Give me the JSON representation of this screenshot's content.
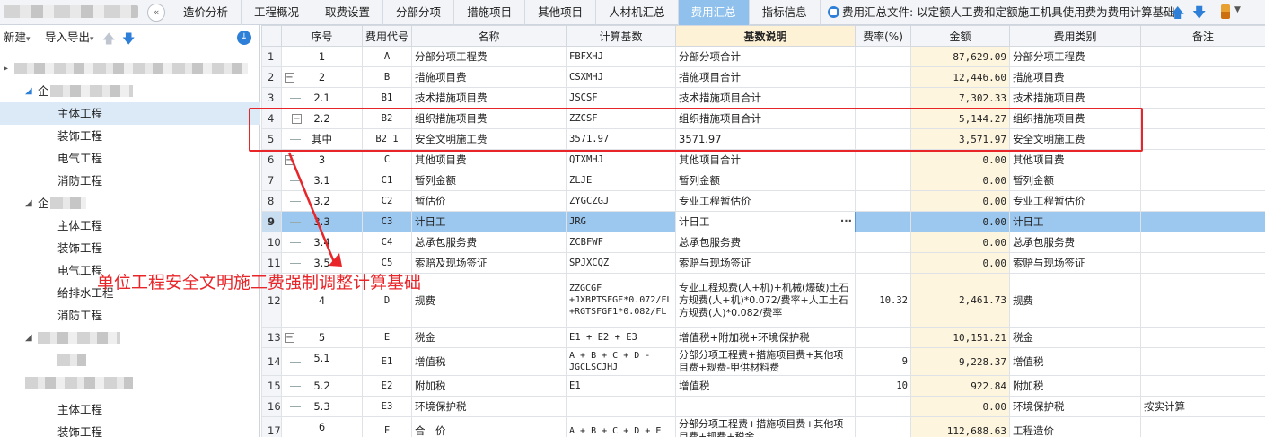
{
  "tabs": [
    "造价分析",
    "工程概况",
    "取费设置",
    "分部分项",
    "措施项目",
    "其他项目",
    "人材机汇总",
    "费用汇总",
    "指标信息"
  ],
  "active_tab": "费用汇总",
  "doc_label": "费用汇总文件: 以定额人工费和定额施工机具使用费为费用计算基础",
  "left_toolbar": {
    "new": "新建",
    "import_export": "导入导出"
  },
  "tree": {
    "group1": [
      "主体工程",
      "装饰工程",
      "电气工程",
      "消防工程"
    ],
    "group2": [
      "主体工程",
      "装饰工程",
      "电气工程",
      "给排水工程",
      "消防工程"
    ],
    "group3": [
      "主体工程",
      "装饰工程"
    ],
    "selected": "主体工程"
  },
  "columns": [
    "序号",
    "费用代号",
    "名称",
    "计算基数",
    "基数说明",
    "费率(%)",
    "金额",
    "费用类别",
    "备注"
  ],
  "rows": [
    {
      "rn": "1",
      "seq": "1",
      "code": "A",
      "name": "分部分项工程费",
      "base": "FBFXHJ",
      "desc": "分部分项合计",
      "rate": "",
      "amt": "87,629.09",
      "cat": "分部分项工程费",
      "note": ""
    },
    {
      "rn": "2",
      "seq": "2",
      "code": "B",
      "name": "措施项目费",
      "base": "CSXMHJ",
      "desc": "措施项目合计",
      "rate": "",
      "amt": "12,446.60",
      "cat": "措施项目费",
      "note": ""
    },
    {
      "rn": "3",
      "seq": "2.1",
      "code": "B1",
      "name": "技术措施项目费",
      "base": "JSCSF",
      "desc": "技术措施项目合计",
      "rate": "",
      "amt": "7,302.33",
      "cat": "技术措施项目费",
      "note": ""
    },
    {
      "rn": "4",
      "seq": "2.2",
      "code": "B2",
      "name": "组织措施项目费",
      "base": "ZZCSF",
      "desc": "组织措施项目合计",
      "rate": "",
      "amt": "5,144.27",
      "cat": "组织措施项目费",
      "note": ""
    },
    {
      "rn": "5",
      "seq": "其中",
      "code": "B2_1",
      "name": "安全文明施工费",
      "base": "3571.97",
      "desc": "3571.97",
      "rate": "",
      "amt": "3,571.97",
      "cat": "安全文明施工费",
      "note": ""
    },
    {
      "rn": "6",
      "seq": "3",
      "code": "C",
      "name": "其他项目费",
      "base": "QTXMHJ",
      "desc": "其他项目合计",
      "rate": "",
      "amt": "0.00",
      "cat": "其他项目费",
      "note": ""
    },
    {
      "rn": "7",
      "seq": "3.1",
      "code": "C1",
      "name": "暂列金额",
      "base": "ZLJE",
      "desc": "暂列金额",
      "rate": "",
      "amt": "0.00",
      "cat": "暂列金额",
      "note": ""
    },
    {
      "rn": "8",
      "seq": "3.2",
      "code": "C2",
      "name": "暂估价",
      "base": "ZYGCZGJ",
      "desc": "专业工程暂估价",
      "rate": "",
      "amt": "0.00",
      "cat": "专业工程暂估价",
      "note": ""
    },
    {
      "rn": "9",
      "seq": "3.3",
      "code": "C3",
      "name": "计日工",
      "base": "JRG",
      "desc": "计日工",
      "rate": "",
      "amt": "0.00",
      "cat": "计日工",
      "note": ""
    },
    {
      "rn": "10",
      "seq": "3.4",
      "code": "C4",
      "name": "总承包服务费",
      "base": "ZCBFWF",
      "desc": "总承包服务费",
      "rate": "",
      "amt": "0.00",
      "cat": "总承包服务费",
      "note": ""
    },
    {
      "rn": "11",
      "seq": "3.5",
      "code": "C5",
      "name": "索赔及现场签证",
      "base": "SPJXCQZ",
      "desc": "索赔与现场签证",
      "rate": "",
      "amt": "0.00",
      "cat": "索赔与现场签证",
      "note": ""
    },
    {
      "rn": "12",
      "seq": "4",
      "code": "D",
      "name": "规费",
      "base": "ZZGCGF +JXBPTSFGF*0.072/FL +RGTSFGF1*0.082/FL",
      "desc": "专业工程规费(人+机)+机械(爆破)土石方规费(人+机)*0.072/费率+人工土石方规费(人)*0.082/费率",
      "rate": "10.32",
      "amt": "2,461.73",
      "cat": "规费",
      "note": ""
    },
    {
      "rn": "13",
      "seq": "5",
      "code": "E",
      "name": "税金",
      "base": "E1 + E2 + E3",
      "desc": "增值税+附加税+环境保护税",
      "rate": "",
      "amt": "10,151.21",
      "cat": "税金",
      "note": ""
    },
    {
      "rn": "14",
      "seq": "5.1",
      "code": "E1",
      "name": "增值税",
      "base": "A + B + C + D - JGCLSCJHJ",
      "desc": "分部分项工程费+措施项目费+其他项目费+规费-甲供材料费",
      "rate": "9",
      "amt": "9,228.37",
      "cat": "增值税",
      "note": ""
    },
    {
      "rn": "15",
      "seq": "5.2",
      "code": "E2",
      "name": "附加税",
      "base": "E1",
      "desc": "增值税",
      "rate": "10",
      "amt": "922.84",
      "cat": "附加税",
      "note": ""
    },
    {
      "rn": "16",
      "seq": "5.3",
      "code": "E3",
      "name": "环境保护税",
      "base": "",
      "desc": "",
      "rate": "",
      "amt": "0.00",
      "cat": "环境保护税",
      "note": "按实计算"
    },
    {
      "rn": "17",
      "seq": "6",
      "code": "F",
      "name": "合　价",
      "base": "A + B + C + D + E",
      "desc": "分部分项工程费+措施项目费+其他项目费+规费+税金",
      "rate": "",
      "amt": "112,688.63",
      "cat": "工程造价",
      "note": ""
    }
  ],
  "annotation": "单位工程安全文明施工费强制调整计算基础"
}
